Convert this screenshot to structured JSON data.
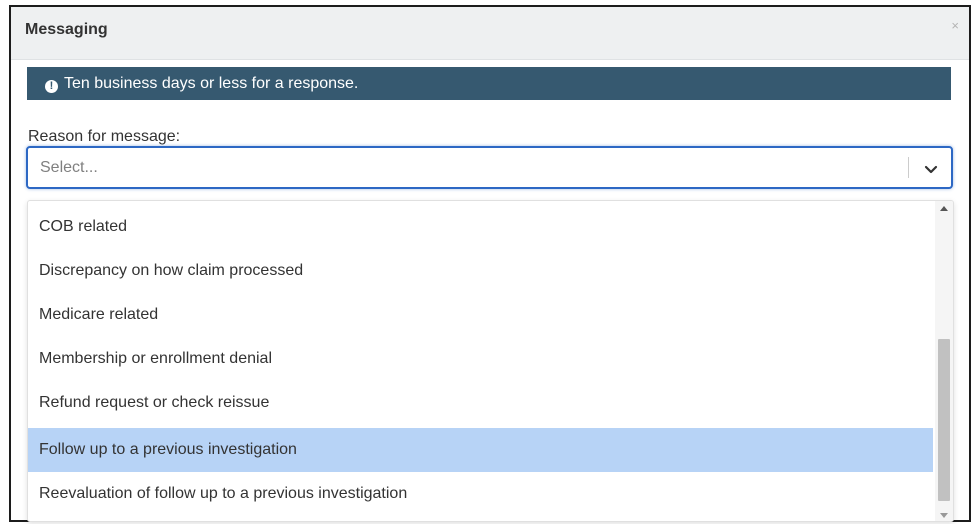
{
  "modal": {
    "title": "Messaging",
    "close_glyph": "×"
  },
  "alert": {
    "icon": "exclamation-circle-icon",
    "text": "Ten business days or less for a response."
  },
  "form": {
    "reason_label": "Reason for message:",
    "select_placeholder": "Select..."
  },
  "dropdown": {
    "options": [
      "COB related",
      "Discrepancy on how claim processed",
      "Medicare related",
      "Membership or enrollment denial",
      "Refund request or check reissue",
      "Follow up to a previous investigation",
      "Reevaluation of follow up to a previous investigation"
    ],
    "highlighted_index": 5
  },
  "colors": {
    "alert_bg": "#365970",
    "select_border": "#2d68c4",
    "highlight": "#b7d3f6"
  }
}
